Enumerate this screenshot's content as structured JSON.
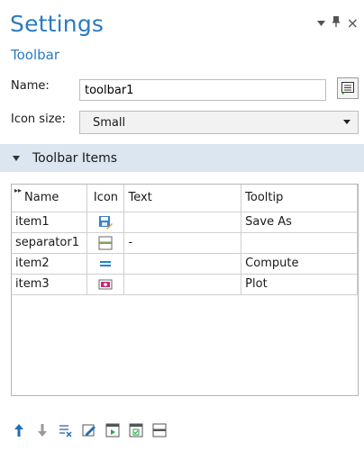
{
  "header": {
    "title": "Settings",
    "subtitle": "Toolbar",
    "controls": {
      "dropdown_icon": "dropdown-arrow-icon",
      "pin_icon": "pin-icon",
      "close_icon": "close-icon",
      "close_glyph": "×"
    }
  },
  "form": {
    "name_label": "Name:",
    "name_value": "toolbar1",
    "icon_size_label": "Icon size:",
    "icon_size_value": "Small"
  },
  "section": {
    "title": "Toolbar Items"
  },
  "table": {
    "columns": [
      "Name",
      "Icon",
      "Text",
      "Tooltip"
    ],
    "rows": [
      {
        "name": "item1",
        "icon": "save-as-icon",
        "text": "",
        "tooltip": "Save As"
      },
      {
        "name": "separator1",
        "icon": "separator-icon",
        "text": "-",
        "tooltip": ""
      },
      {
        "name": "item2",
        "icon": "compute-icon",
        "text": "",
        "tooltip": "Compute"
      },
      {
        "name": "item3",
        "icon": "plot-icon",
        "text": "",
        "tooltip": "Plot"
      }
    ]
  },
  "bottom_toolbar": [
    "move-up-icon",
    "move-down-icon",
    "delete-items-icon",
    "edit-icon",
    "add-button-icon",
    "add-checkbox-icon",
    "add-separator-icon"
  ],
  "colors": {
    "accent": "#2b7bbf",
    "section_bg": "#dce6f0"
  }
}
